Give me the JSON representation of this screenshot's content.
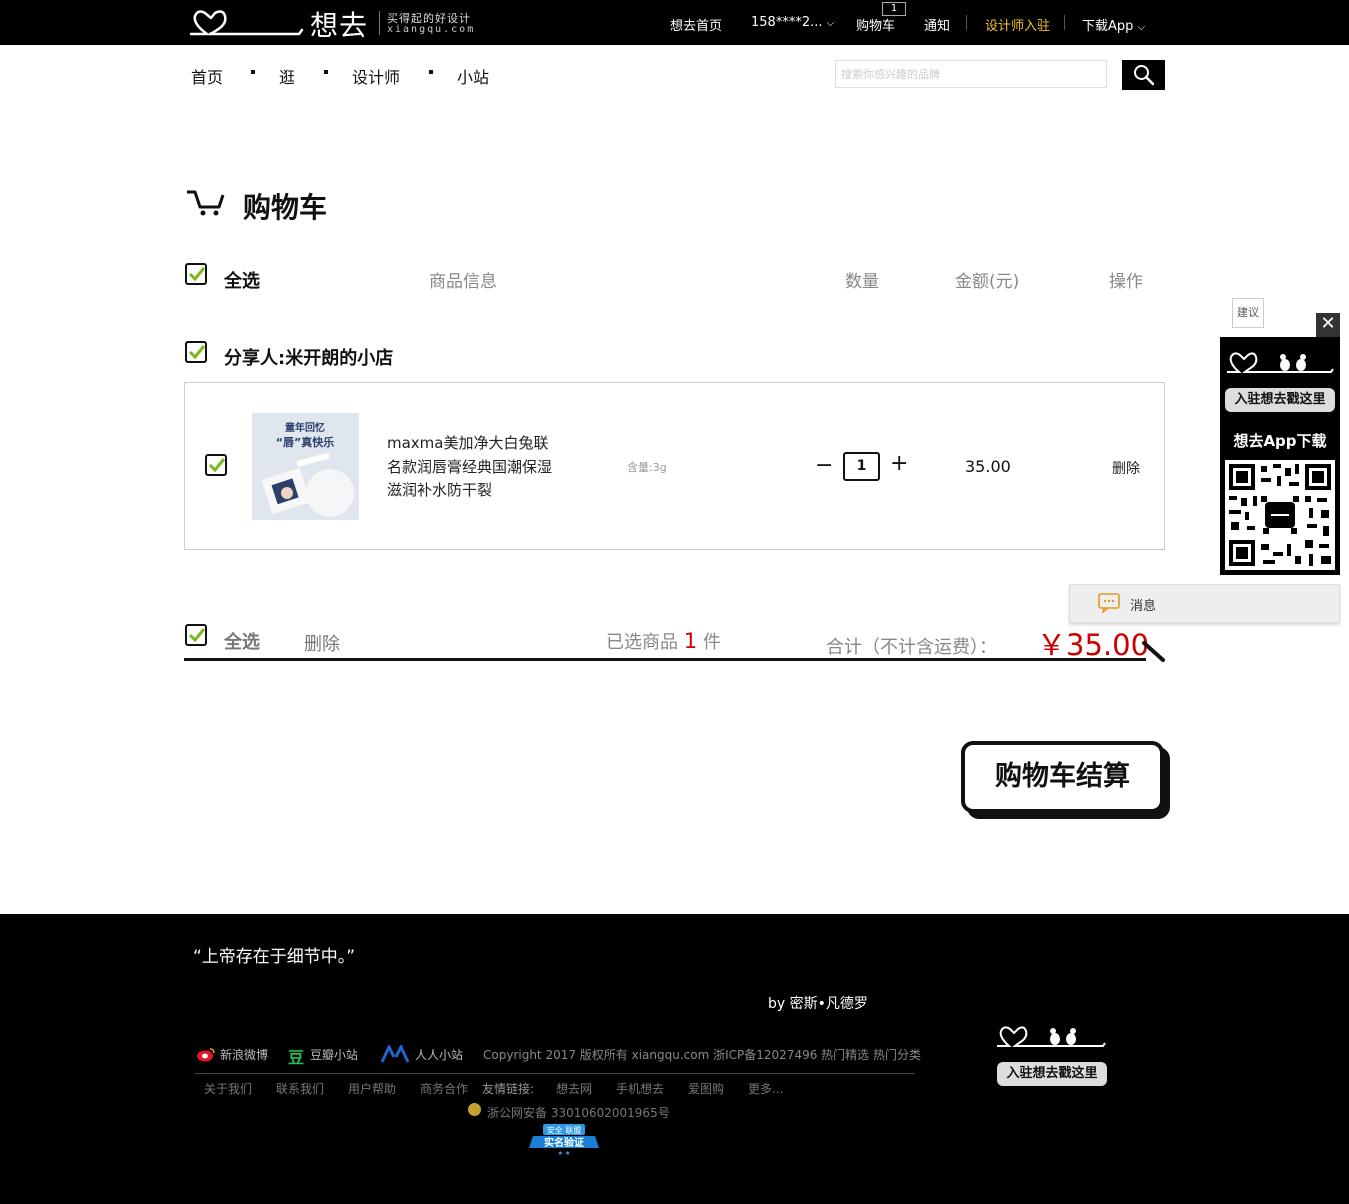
{
  "header": {
    "logo_text": "想去",
    "slogan": "买得起的好设计",
    "domain": "xiangqu.com",
    "links": {
      "home": "想去首页",
      "account": "158****2...",
      "cart": "购物车",
      "cart_count": "1",
      "notice": "通知",
      "designer": "设计师入驻",
      "app": "下载App"
    }
  },
  "nav": {
    "items": [
      "首页",
      "逛",
      "设计师",
      "小站"
    ],
    "search_placeholder": "搜索你感兴趣的品牌"
  },
  "cart": {
    "title": "购物车",
    "headers": {
      "select_all": "全选",
      "info": "商品信息",
      "qty": "数量",
      "amount": "金额(元)",
      "action": "操作"
    },
    "shop_name": "分享人:米开朗的小店",
    "item": {
      "name": "maxma美加净大白兔联名款润唇膏经典国潮保湿滋润补水防干裂",
      "spec": "含量:3g",
      "minus": "−",
      "qty": "1",
      "plus": "+",
      "price": "35.00",
      "delete": "删除",
      "img_text_1": "童年回忆",
      "img_text_2": "“唇”真快乐"
    },
    "summary": {
      "select_all": "全选",
      "delete": "删除",
      "selected_prefix": "已选商品",
      "selected_count": "1",
      "selected_suffix": "件",
      "total_label": "合计（不计含运费）：",
      "total": "￥35.00"
    },
    "checkout": "购物车结算"
  },
  "float": {
    "suggest": "建议",
    "close": "✕",
    "join": "入驻想去戳这里",
    "app": "想去App下载",
    "message": "消息"
  },
  "footer": {
    "quote": "“上帝存在于细节中。”",
    "quote_by": "by  密斯•凡德罗",
    "social": [
      "新浪微博",
      "豆瓣小站",
      "人人小站"
    ],
    "copyright": "Copyright 2017 版权所有 xiangqu.com 浙ICP备12027496  热门精选   热门分类",
    "links": [
      "关于我们",
      "联系我们",
      "用户帮助",
      "商务合作",
      "友情链接:",
      "想去网",
      "手机想去",
      "爱图购",
      "更多..."
    ],
    "police": "浙公网安备 33010602001965号",
    "badge_top": "安全 联盟",
    "badge_main": "实名验证",
    "join": "入驻想去戳这里"
  },
  "colors": {
    "accent_gold": "#f0c32c",
    "price_red": "#cc0000",
    "check_green": "#7cb820"
  }
}
